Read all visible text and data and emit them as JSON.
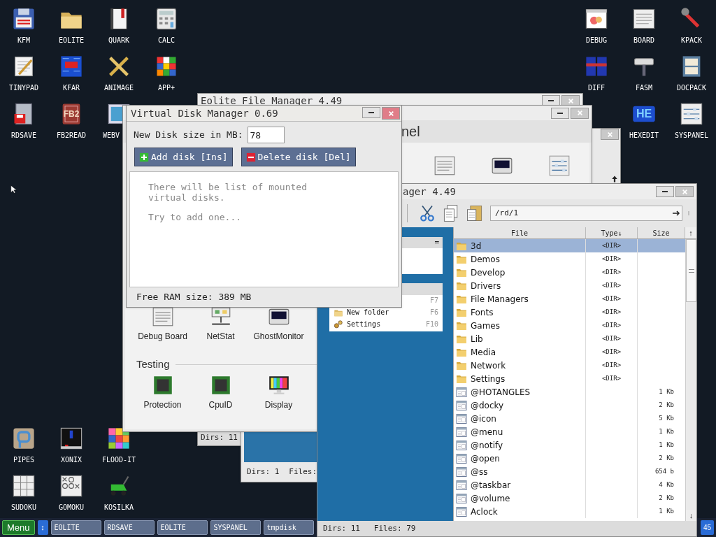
{
  "desktop_left": [
    {
      "label": "KFM"
    },
    {
      "label": "EOLITE"
    },
    {
      "label": "QUARK"
    },
    {
      "label": "CALC"
    },
    {
      "label": "TINYPAD"
    },
    {
      "label": "KFAR"
    },
    {
      "label": "ANIMAGE"
    },
    {
      "label": "APP+"
    },
    {
      "label": "RDSAVE"
    },
    {
      "label": "FB2READ",
      "logo_text": "FB2"
    },
    {
      "label": "WEBV"
    }
  ],
  "desktop_right": [
    {
      "label": "DEBUG"
    },
    {
      "label": "BOARD"
    },
    {
      "label": "KPACK"
    },
    {
      "label": "DIFF"
    },
    {
      "label": "FASM"
    },
    {
      "label": "DOCPACK"
    },
    {
      "label": "HEXEDIT",
      "logo_text": "HE"
    },
    {
      "label": "SYSPANEL"
    }
  ],
  "desktop_bottom": [
    {
      "label": "PIPES"
    },
    {
      "label": "XONIX"
    },
    {
      "label": "FLOOD-IT"
    },
    {
      "label": "SUDOKU"
    },
    {
      "label": "GOMOKU"
    },
    {
      "label": "KOSILKA"
    }
  ],
  "eolite_back": {
    "title": "Eolite File Manager 4.49",
    "status": "Dirs: 11"
  },
  "syspanel": {
    "heading": "nel",
    "items": [
      {
        "label": "Debug Board"
      },
      {
        "label": "NetStat"
      },
      {
        "label": "GhostMonitor"
      }
    ],
    "section": "Testing",
    "section_items": [
      {
        "label": "Protection"
      },
      {
        "label": "CpuID"
      },
      {
        "label": "Display"
      }
    ]
  },
  "eolite_small": {
    "status_dirs": "Dirs: 1",
    "status_files": "Files:"
  },
  "eolite_front": {
    "title": "ager 4.49",
    "path": "/rd/1",
    "menu_header": "=",
    "menu": [
      {
        "label": "New folder",
        "key": "F6"
      },
      {
        "label": "Settings",
        "key": "F10"
      }
    ],
    "hidden_key": "F7",
    "columns": [
      {
        "label": "File"
      },
      {
        "label": "Type↓"
      },
      {
        "label": "Size"
      }
    ],
    "scroll_up": "↑",
    "scroll_down": "↓",
    "rows": [
      {
        "kind": "dir",
        "name": "3d",
        "type": "<DIR>",
        "selected": true
      },
      {
        "kind": "dir",
        "name": "Demos",
        "type": "<DIR>",
        "selected": false
      },
      {
        "kind": "dir",
        "name": "Develop",
        "type": "<DIR>",
        "selected": false
      },
      {
        "kind": "dir",
        "name": "Drivers",
        "type": "<DIR>",
        "selected": false
      },
      {
        "kind": "dir",
        "name": "File Managers",
        "type": "<DIR>",
        "selected": false
      },
      {
        "kind": "dir",
        "name": "Fonts",
        "type": "<DIR>",
        "selected": false
      },
      {
        "kind": "dir",
        "name": "Games",
        "type": "<DIR>",
        "selected": false
      },
      {
        "kind": "dir",
        "name": "Lib",
        "type": "<DIR>",
        "selected": false
      },
      {
        "kind": "dir",
        "name": "Media",
        "type": "<DIR>",
        "selected": false
      },
      {
        "kind": "dir",
        "name": "Network",
        "type": "<DIR>",
        "selected": false
      },
      {
        "kind": "dir",
        "name": "Settings",
        "type": "<DIR>",
        "selected": false
      },
      {
        "kind": "file",
        "name": "@HOTANGLES",
        "size": "1 Kb",
        "selected": false
      },
      {
        "kind": "file",
        "name": "@docky",
        "size": "2 Kb",
        "selected": false
      },
      {
        "kind": "file",
        "name": "@icon",
        "size": "5 Kb",
        "selected": false
      },
      {
        "kind": "file",
        "name": "@menu",
        "size": "1 Kb",
        "selected": false
      },
      {
        "kind": "file",
        "name": "@notify",
        "size": "1 Kb",
        "selected": false
      },
      {
        "kind": "file",
        "name": "@open",
        "size": "2 Kb",
        "selected": false
      },
      {
        "kind": "file",
        "name": "@ss",
        "size": "654 b",
        "selected": false
      },
      {
        "kind": "file",
        "name": "@taskbar",
        "size": "4 Kb",
        "selected": false
      },
      {
        "kind": "file",
        "name": "@volume",
        "size": "2 Kb",
        "selected": false
      },
      {
        "kind": "file",
        "name": "Aclock",
        "size": "1 Kb",
        "selected": false
      }
    ],
    "status": "Dirs: 11   Files: 79"
  },
  "vdm": {
    "title": "Virtual Disk Manager 0.69",
    "size_label": "New Disk size in MB:",
    "size_value": "78",
    "add_button": "Add disk [Ins]",
    "delete_button": "Delete disk [Del]",
    "info": [
      "There will be list of mounted virtual disks.",
      "Try to add one..."
    ],
    "footer": "Free RAM size: 389 MB"
  },
  "taskbar": {
    "menu": "Menu",
    "switch": "↕",
    "tasks": [
      {
        "label": "EOLITE"
      },
      {
        "label": "RDSAVE"
      },
      {
        "label": "EOLITE"
      },
      {
        "label": "SYSPANEL"
      },
      {
        "label": "tmpdisk"
      }
    ],
    "tray": "45"
  }
}
